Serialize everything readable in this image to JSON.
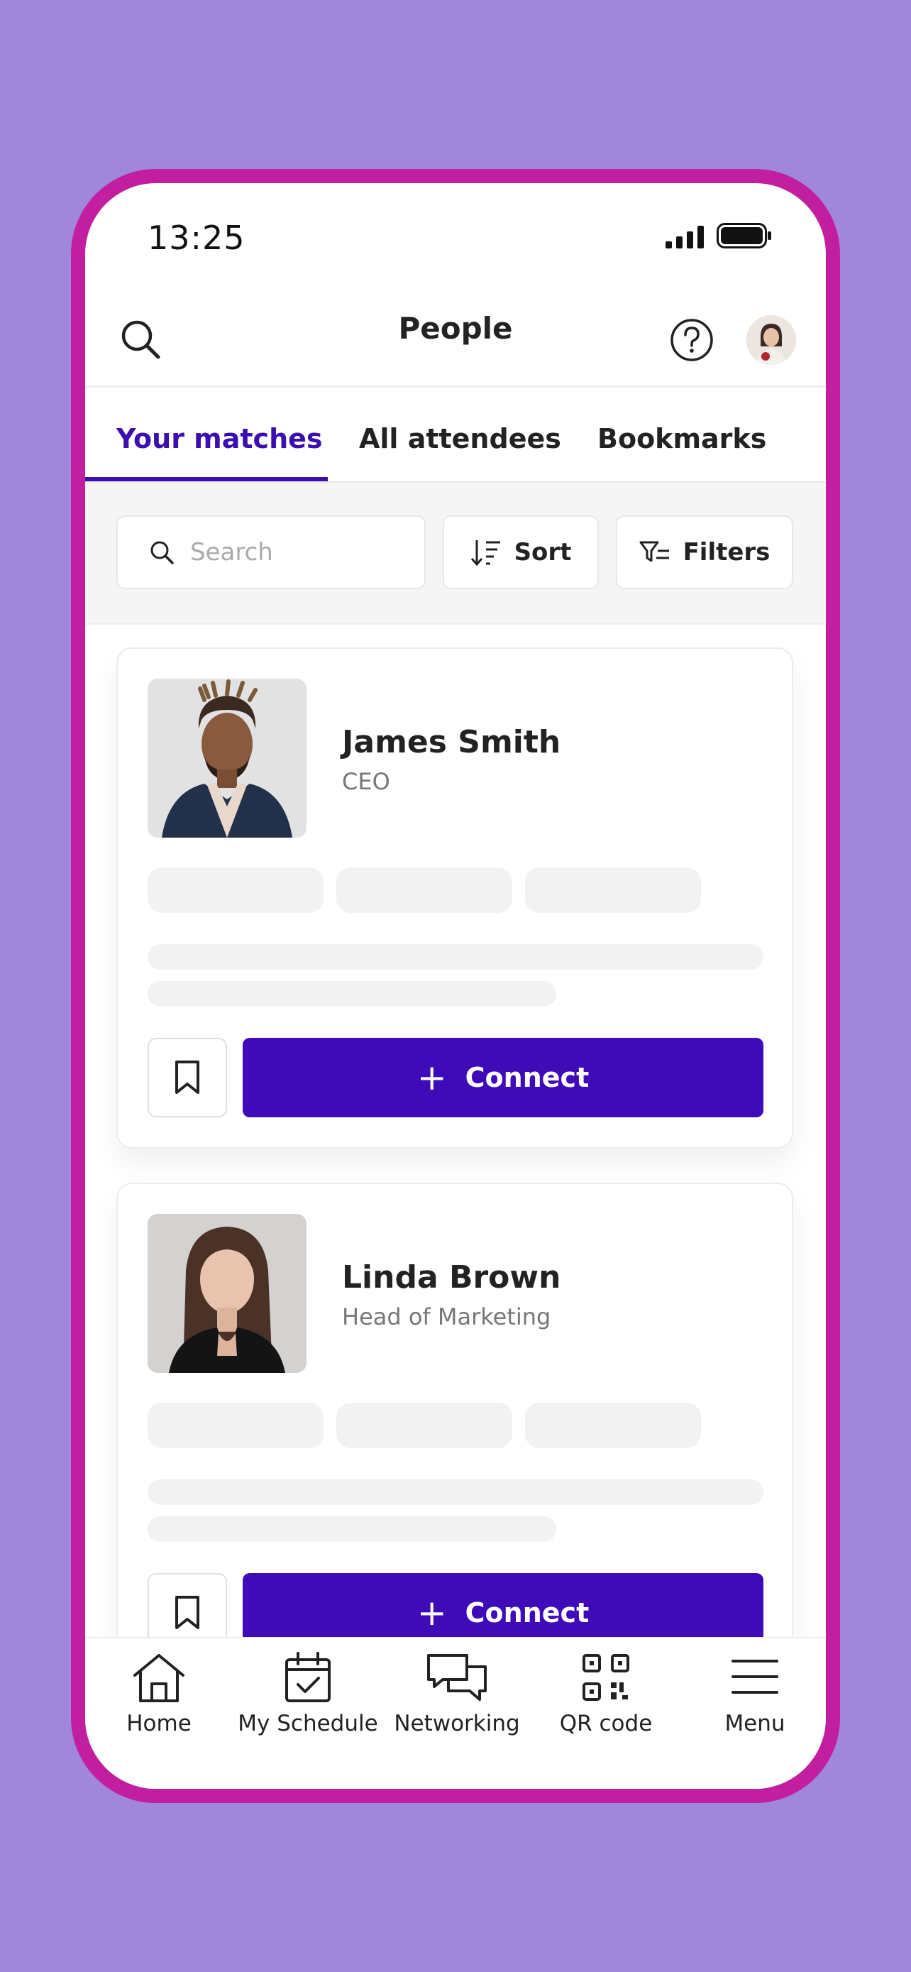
{
  "status": {
    "time": "13:25"
  },
  "header": {
    "title": "People"
  },
  "tabs": [
    {
      "label": "Your matches",
      "active": true
    },
    {
      "label": "All attendees",
      "active": false
    },
    {
      "label": "Bookmarks",
      "active": false
    }
  ],
  "filters": {
    "search_placeholder": "Search",
    "sort_label": "Sort",
    "filters_label": "Filters"
  },
  "people": [
    {
      "name": "James Smith",
      "role": "CEO",
      "connect_label": "Connect"
    },
    {
      "name": "Linda Brown",
      "role": "Head of Marketing",
      "connect_label": "Connect"
    }
  ],
  "nav": [
    {
      "label": "Home",
      "icon": "home-icon"
    },
    {
      "label": "My Schedule",
      "icon": "calendar-check-icon"
    },
    {
      "label": "Networking",
      "icon": "chat-bubbles-icon"
    },
    {
      "label": "QR code",
      "icon": "qr-code-icon"
    },
    {
      "label": "Menu",
      "icon": "hamburger-menu-icon"
    }
  ],
  "colors": {
    "background": "#a087dc",
    "frame": "#c21fa0",
    "accent": "#3f0bb8",
    "active_tab": "#3a0fae"
  }
}
